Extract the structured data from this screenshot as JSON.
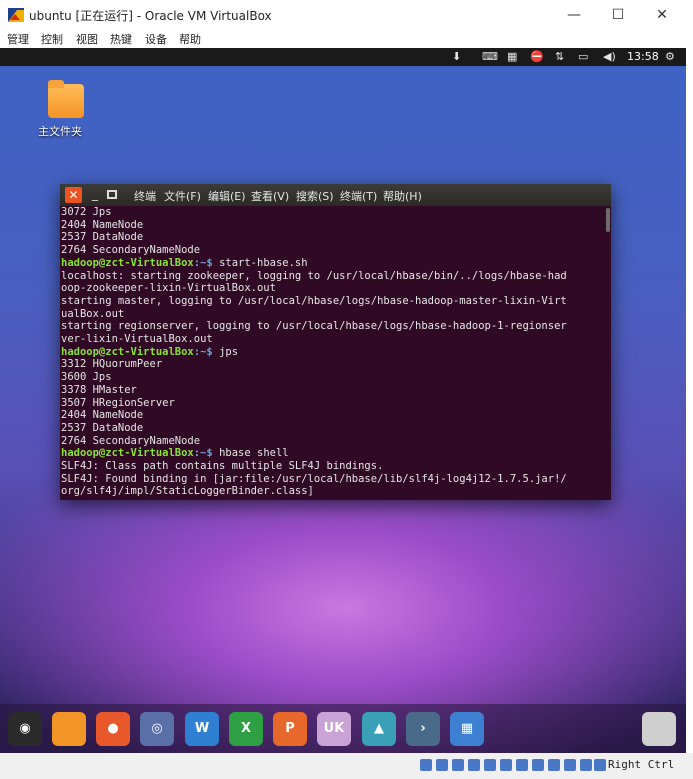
{
  "host": {
    "title": "ubuntu [正在运行] - Oracle VM VirtualBox",
    "controls": {
      "minimize": "—",
      "maximize": "☐",
      "close": "✕"
    },
    "menu": [
      "管理",
      "控制",
      "视图",
      "热键",
      "设备",
      "帮助"
    ],
    "status_host_key": "Right Ctrl"
  },
  "guest": {
    "clock": "13:58",
    "desktop_icon_label": "主文件夹"
  },
  "terminal": {
    "menu": [
      "终端",
      "文件(F)",
      "编辑(E)",
      "查看(V)",
      "搜索(S)",
      "终端(T)",
      "帮助(H)"
    ],
    "prompt_user": "hadoop@zct-VirtualBox",
    "prompt_suffix": ":~$ ",
    "lines": [
      {
        "t": "3072 Jps"
      },
      {
        "t": "2404 NameNode"
      },
      {
        "t": "2537 DataNode"
      },
      {
        "t": "2764 SecondaryNameNode"
      },
      {
        "prompt": true,
        "t": "start-hbase.sh"
      },
      {
        "t": "localhost: starting zookeeper, logging to /usr/local/hbase/bin/../logs/hbase-had"
      },
      {
        "t": "oop-zookeeper-lixin-VirtualBox.out"
      },
      {
        "t": "starting master, logging to /usr/local/hbase/logs/hbase-hadoop-master-lixin-Virt"
      },
      {
        "t": "ualBox.out"
      },
      {
        "t": "starting regionserver, logging to /usr/local/hbase/logs/hbase-hadoop-1-regionser"
      },
      {
        "t": "ver-lixin-VirtualBox.out"
      },
      {
        "prompt": true,
        "t": "jps"
      },
      {
        "t": "3312 HQuorumPeer"
      },
      {
        "t": "3600 Jps"
      },
      {
        "t": "3378 HMaster"
      },
      {
        "t": "3507 HRegionServer"
      },
      {
        "t": "2404 NameNode"
      },
      {
        "t": "2537 DataNode"
      },
      {
        "t": "2764 SecondaryNameNode"
      },
      {
        "prompt": true,
        "t": "hbase shell"
      },
      {
        "t": "SLF4J: Class path contains multiple SLF4J bindings."
      },
      {
        "t": "SLF4J: Found binding in [jar:file:/usr/local/hbase/lib/slf4j-log4j12-1.7.5.jar!/"
      },
      {
        "t": "org/slf4j/impl/StaticLoggerBinder.class]"
      }
    ]
  },
  "dock": {
    "items": [
      {
        "name": "ubuntu-logo-icon",
        "color": "#2b2b2b",
        "glyph": "◉"
      },
      {
        "name": "files-icon",
        "color": "#f39426",
        "glyph": ""
      },
      {
        "name": "firefox-icon",
        "color": "#e8582b",
        "glyph": "●"
      },
      {
        "name": "browser-icon",
        "color": "#5b6fa8",
        "glyph": "◎"
      },
      {
        "name": "writer-icon",
        "color": "#2f7fd2",
        "glyph": "W"
      },
      {
        "name": "calc-icon",
        "color": "#2ea043",
        "glyph": "X"
      },
      {
        "name": "impress-icon",
        "color": "#e8672b",
        "glyph": "P"
      },
      {
        "name": "software-center-icon",
        "color": "#c9a2d6",
        "glyph": "UK"
      },
      {
        "name": "system-update-icon",
        "color": "#3aa0b8",
        "glyph": "▲"
      },
      {
        "name": "terminal-icon",
        "color": "#4a6a8a",
        "glyph": "›"
      },
      {
        "name": "workspace-icon",
        "color": "#3d7fd0",
        "glyph": "▦"
      },
      {
        "name": "trash-icon",
        "color": "#cfcfcf",
        "glyph": ""
      }
    ]
  }
}
